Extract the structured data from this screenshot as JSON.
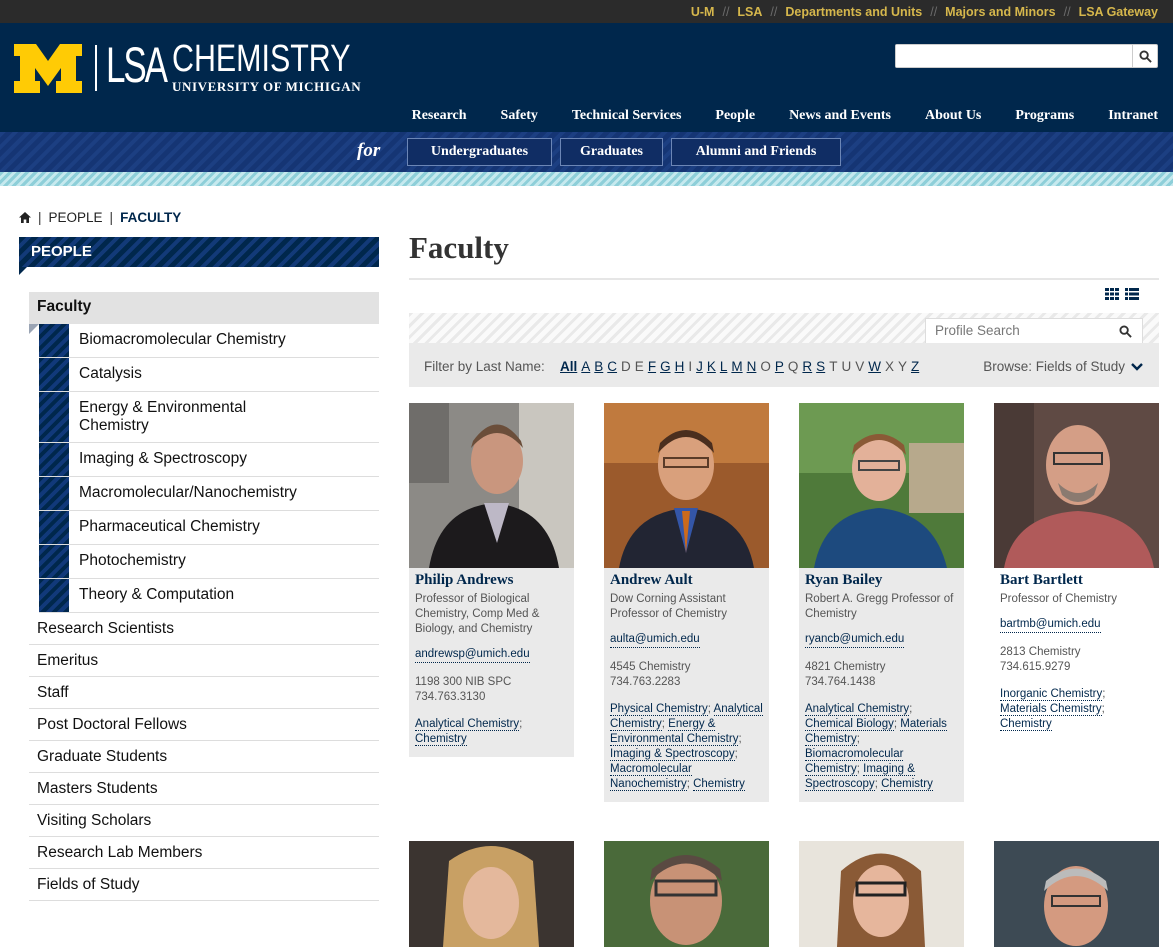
{
  "topbar": {
    "links": [
      "U-M",
      "LSA",
      "Departments and Units",
      "Majors and Minors",
      "LSA Gateway"
    ]
  },
  "logo": {
    "lsa": "LSA",
    "chemistry": "CHEMISTRY",
    "university": "UNIVERSITY OF MICHIGAN"
  },
  "search": {
    "placeholder": ""
  },
  "mainnav": [
    "Research",
    "Safety",
    "Technical Services",
    "People",
    "News and Events",
    "About Us",
    "Programs",
    "Intranet"
  ],
  "forbar": {
    "for_label": "for",
    "audiences": [
      "Undergraduates",
      "Graduates",
      "Alumni and Friends"
    ]
  },
  "breadcrumb": {
    "people": "PEOPLE",
    "current": "FACULTY"
  },
  "sidebar": {
    "heading": "PEOPLE",
    "active": "Faculty",
    "subitems": [
      "Biomacromolecular Chemistry",
      "Catalysis",
      "Energy & Environmental Chemistry",
      "Imaging & Spectroscopy",
      "Macromolecular/Nanochemistry",
      "Pharmaceutical Chemistry",
      "Photochemistry",
      "Theory & Computation"
    ],
    "items": [
      "Research Scientists",
      "Emeritus",
      "Staff",
      "Post Doctoral Fellows",
      "Graduate Students",
      "Masters Students",
      "Visiting Scholars",
      "Research Lab Members",
      "Fields of Study"
    ]
  },
  "main": {
    "title": "Faculty",
    "profile_search_placeholder": "Profile Search",
    "filter_label": "Filter by Last Name:",
    "letters": [
      "All",
      "A",
      "B",
      "C",
      "D",
      "E",
      "F",
      "G",
      "H",
      "I",
      "J",
      "K",
      "L",
      "M",
      "N",
      "O",
      "P",
      "Q",
      "R",
      "S",
      "T",
      "U",
      "V",
      "W",
      "X",
      "Y",
      "Z"
    ],
    "browse_label": "Browse: Fields of Study"
  },
  "faculty": [
    {
      "name": "Philip Andrews",
      "title": "Professor of Biological Chemistry, Comp Med & Biology, and Chemistry",
      "email": "andrewsp@umich.edu",
      "office": "1198 300 NIB SPC",
      "phone": "734.763.3130",
      "fields": [
        "Analytical Chemistry",
        "Chemistry"
      ]
    },
    {
      "name": "Andrew Ault",
      "title": "Dow Corning Assistant Professor of Chemistry",
      "email": "aulta@umich.edu",
      "office": "4545 Chemistry",
      "phone": "734.763.2283",
      "fields": [
        "Physical Chemistry",
        "Analytical Chemistry",
        "Energy & Environmental Chemistry",
        "Imaging & Spectroscopy",
        "Macromolecular Nanochemistry",
        "Chemistry"
      ]
    },
    {
      "name": "Ryan Bailey",
      "title": "Robert A. Gregg Professor of Chemistry",
      "email": "ryancb@umich.edu",
      "office": "4821 Chemistry",
      "phone": "734.764.1438",
      "fields": [
        "Analytical Chemistry",
        "Chemical Biology",
        "Materials Chemistry",
        "Biomacromolecular Chemistry",
        "Imaging & Spectroscopy",
        "Chemistry"
      ]
    },
    {
      "name": "Bart Bartlett",
      "title": "Professor of Chemistry",
      "email": "bartmb@umich.edu",
      "office": "2813 Chemistry",
      "phone": "734.615.9279",
      "fields": [
        "Inorganic Chemistry",
        "Materials Chemistry",
        "Chemistry"
      ]
    }
  ],
  "colors": {
    "navy": "#00274c",
    "maize": "#ffcb05",
    "gold_link": "#d6b74c"
  }
}
